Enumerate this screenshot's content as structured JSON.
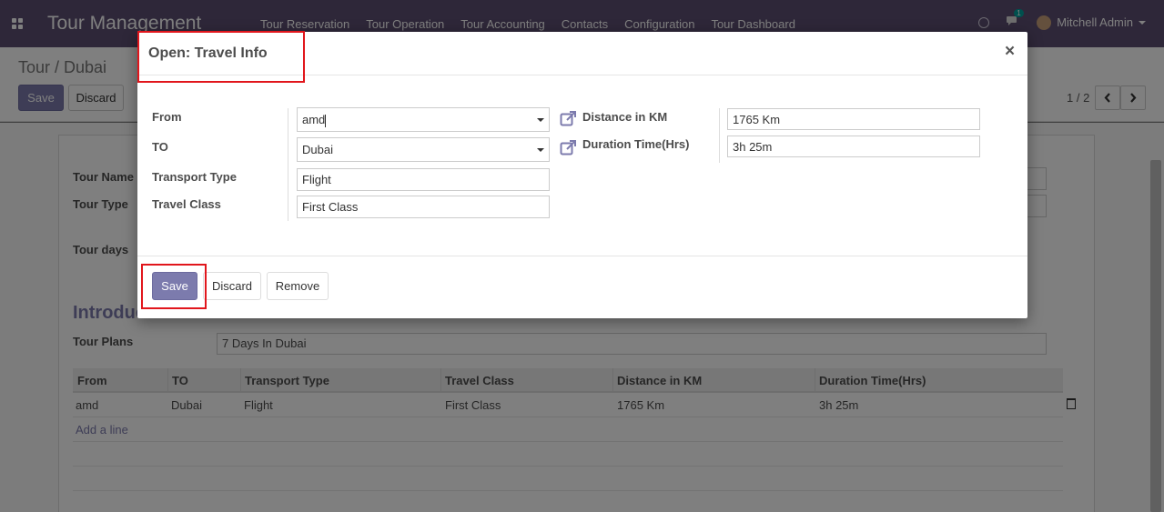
{
  "app": {
    "brand": "Tour Management",
    "menu": [
      "Tour Reservation",
      "Tour Operation",
      "Tour Accounting",
      "Contacts",
      "Configuration",
      "Tour Dashboard"
    ],
    "chat_badge": "1",
    "user_name": "Mitchell Admin"
  },
  "control_panel": {
    "breadcrumb": "Tour / Dubai",
    "save_label": "Save",
    "discard_label": "Discard",
    "pager": "1 / 2"
  },
  "form": {
    "tour_name_label": "Tour Name",
    "tour_type_label": "Tour Type",
    "tour_days_label": "Tour days",
    "section_title": "Introduction",
    "tour_plans_label": "Tour Plans",
    "tour_plans_value": "7 Days In Dubai",
    "table": {
      "headers": [
        "From",
        "TO",
        "Transport Type",
        "Travel Class",
        "Distance in KM",
        "Duration Time(Hrs)"
      ],
      "rows": [
        [
          "amd",
          "Dubai",
          "Flight",
          "First Class",
          "1765 Km",
          "3h 25m"
        ]
      ],
      "add_line": "Add a line"
    }
  },
  "modal": {
    "title": "Open: Travel Info",
    "close": "×",
    "fields": {
      "from_label": "From",
      "from_value": "amd",
      "to_label": "TO",
      "to_value": "Dubai",
      "transport_label": "Transport Type",
      "transport_value": "Flight",
      "class_label": "Travel Class",
      "class_value": "First Class",
      "distance_label": "Distance in KM",
      "distance_value": "1765 Km",
      "duration_label": "Duration Time(Hrs)",
      "duration_value": "3h 25m"
    },
    "buttons": {
      "save": "Save",
      "discard": "Discard",
      "remove": "Remove"
    }
  },
  "colors": {
    "navbar": "#5d4f73",
    "primary": "#7c7bad",
    "highlight": "#e1161c"
  }
}
